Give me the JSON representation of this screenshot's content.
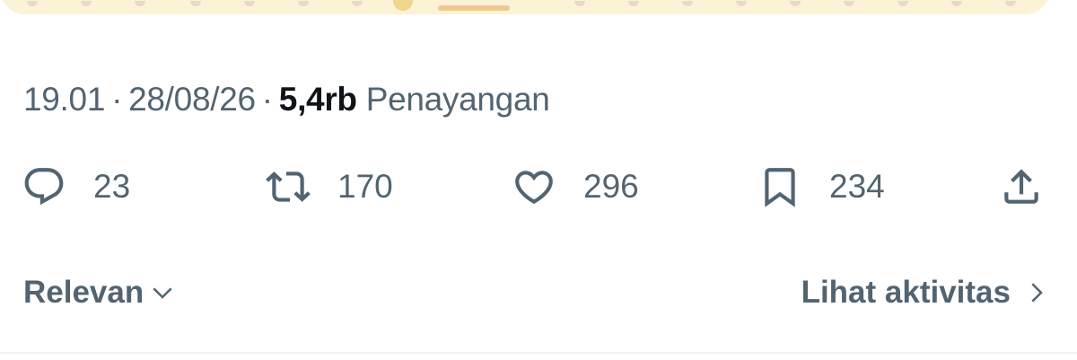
{
  "post_meta": {
    "time": "19.01",
    "separator": "·",
    "date": "28/08/26",
    "views_count": "5,4rb",
    "views_label": "Penayangan"
  },
  "actions": {
    "reply": {
      "icon": "reply-icon",
      "count": "23"
    },
    "repost": {
      "icon": "repost-icon",
      "count": "170"
    },
    "like": {
      "icon": "heart-icon",
      "count": "296"
    },
    "bookmark": {
      "icon": "bookmark-icon",
      "count": "234"
    },
    "share": {
      "icon": "share-icon"
    }
  },
  "replies_bar": {
    "sort_label": "Relevan",
    "sort_icon": "chevron-down-icon",
    "activity_label": "Lihat aktivitas",
    "activity_icon": "chevron-right-icon"
  },
  "colors": {
    "secondary_text": "#536471",
    "primary_text": "#0f1419",
    "media_background": "#fcf2d6",
    "divider": "#eff3f4"
  }
}
